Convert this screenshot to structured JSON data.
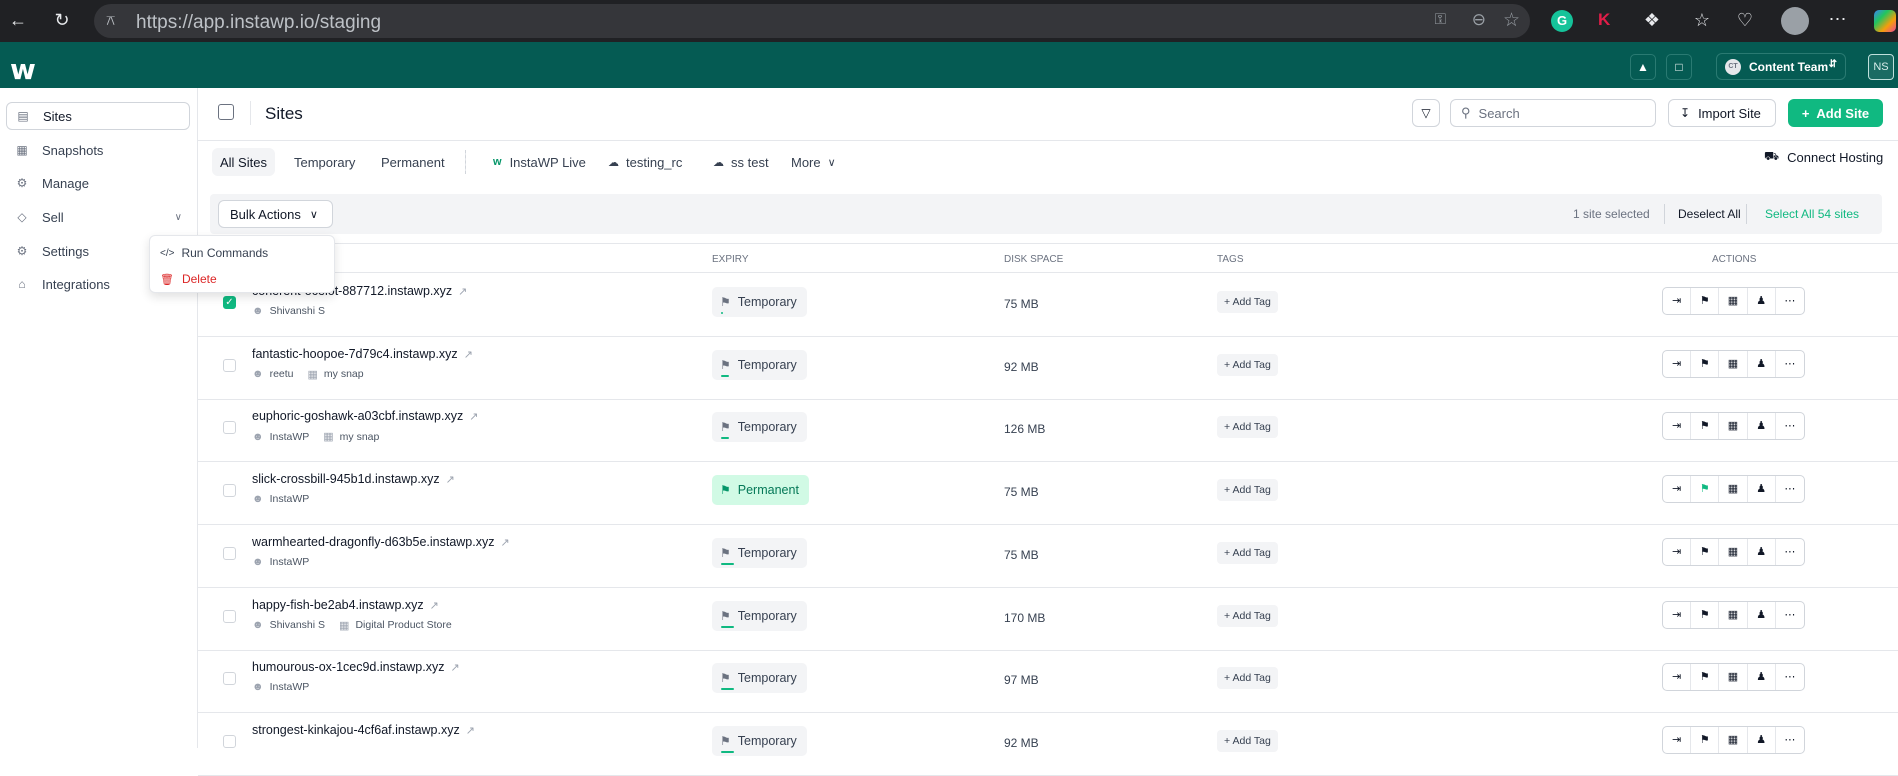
{
  "browser": {
    "url": "https://app.instawp.io/staging"
  },
  "header": {
    "team": "Content Team",
    "team_initials": "CT",
    "user_initials": "NS"
  },
  "sidebar": {
    "items": [
      {
        "label": "Sites",
        "icon": "sites-icon",
        "active": true
      },
      {
        "label": "Snapshots",
        "icon": "snapshots-icon"
      },
      {
        "label": "Manage",
        "icon": "manage-icon"
      },
      {
        "label": "Sell",
        "icon": "tag-icon"
      },
      {
        "label": "Settings",
        "icon": "gear-icon"
      },
      {
        "label": "Integrations",
        "icon": "integrations-icon"
      }
    ]
  },
  "page": {
    "title": "Sites"
  },
  "toolbar": {
    "search_placeholder": "Search",
    "import_label": "Import Site",
    "add_label": "Add Site"
  },
  "tabs": [
    "All Sites",
    "Temporary",
    "Permanent",
    "InstaWP Live",
    "testing_rc",
    "ss test",
    "More"
  ],
  "connect_hosting": "Connect Hosting",
  "bulk": {
    "label": "Bulk Actions",
    "selected_text": "1 site selected",
    "deselect": "Deselect All",
    "select_all": "Select All 54 sites"
  },
  "dropdown": {
    "items": [
      "Run Commands",
      "Delete"
    ]
  },
  "columns": {
    "expiry": "EXPIRY",
    "disk": "DISK SPACE",
    "tags": "TAGS",
    "actions": "ACTIONS"
  },
  "add_tag": "+ Add Tag",
  "rows": [
    {
      "name": "coherent-ocelot-887712.instawp.xyz",
      "user": "Shivanshi S",
      "snap": "",
      "expiry": "Temporary",
      "disk": "75 MB",
      "checked": true,
      "progress": 0.03
    },
    {
      "name": "fantastic-hoopoe-7d79c4.instawp.xyz",
      "user": "reetu",
      "snap": "my snap",
      "expiry": "Temporary",
      "disk": "92 MB",
      "checked": false,
      "progress": 0.12
    },
    {
      "name": "euphoric-goshawk-a03cbf.instawp.xyz",
      "user": "InstaWP",
      "snap": "my snap",
      "expiry": "Temporary",
      "disk": "126 MB",
      "checked": false,
      "progress": 0.12
    },
    {
      "name": "slick-crossbill-945b1d.instawp.xyz",
      "user": "InstaWP",
      "snap": "",
      "expiry": "Permanent",
      "disk": "75 MB",
      "checked": false,
      "progress": 0
    },
    {
      "name": "warmhearted-dragonfly-d63b5e.instawp.xyz",
      "user": "InstaWP",
      "snap": "",
      "expiry": "Temporary",
      "disk": "75 MB",
      "checked": false,
      "progress": 0.18
    },
    {
      "name": "happy-fish-be2ab4.instawp.xyz",
      "user": "Shivanshi S",
      "snap": "Digital Product Store",
      "expiry": "Temporary",
      "disk": "170 MB",
      "checked": false,
      "progress": 0.18
    },
    {
      "name": "humourous-ox-1cec9d.instawp.xyz",
      "user": "InstaWP",
      "snap": "",
      "expiry": "Temporary",
      "disk": "97 MB",
      "checked": false,
      "progress": 0.18
    },
    {
      "name": "strongest-kinkajou-4cf6af.instawp.xyz",
      "user": "",
      "snap": "",
      "expiry": "Temporary",
      "disk": "92 MB",
      "checked": false,
      "progress": 0.18
    }
  ]
}
